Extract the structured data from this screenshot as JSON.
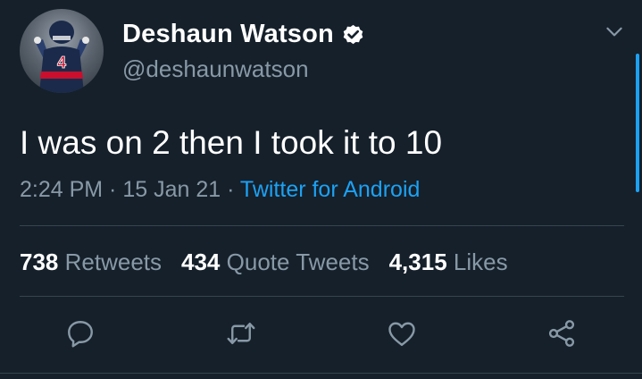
{
  "tweet": {
    "author": {
      "display_name": "Deshaun Watson",
      "handle": "@deshaunwatson",
      "verified": true,
      "avatar_icon": "player-avatar-icon"
    },
    "text": "I was on 2 then I took it to 10",
    "time": "2:24 PM",
    "separator": " · ",
    "date": "15 Jan 21",
    "source": "Twitter for Android"
  },
  "stats": {
    "retweets_count": "738",
    "retweets_label": "Retweets",
    "quotes_count": "434",
    "quotes_label": "Quote Tweets",
    "likes_count": "4,315",
    "likes_label": "Likes"
  },
  "actions": [
    "reply-icon",
    "retweet-icon",
    "like-icon",
    "share-icon"
  ],
  "colors": {
    "background": "#15202b",
    "text": "#ffffff",
    "secondary": "#8899a6",
    "accent": "#1da1f2",
    "divider": "#38444d"
  }
}
